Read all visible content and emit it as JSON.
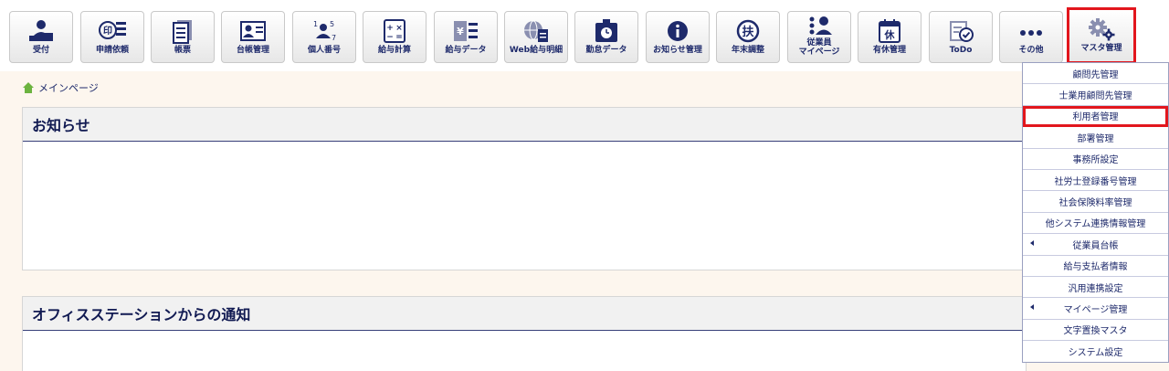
{
  "toolbar": {
    "buttons": [
      {
        "id": "uketsuke",
        "label": "受付",
        "icon": "reception-icon"
      },
      {
        "id": "shinsei",
        "label": "申請依頼",
        "icon": "seal-stamp-icon"
      },
      {
        "id": "chohyo",
        "label": "帳票",
        "icon": "document-stack-icon"
      },
      {
        "id": "daicho",
        "label": "台帳管理",
        "icon": "id-card-icon"
      },
      {
        "id": "kojin",
        "label": "個人番号",
        "icon": "person-number-icon"
      },
      {
        "id": "kyuyo",
        "label": "給与計算",
        "icon": "calculator-icon"
      },
      {
        "id": "kyuyodata",
        "label": "給与データ",
        "icon": "yen-list-icon"
      },
      {
        "id": "webmeisai",
        "label": "Web給与明細",
        "icon": "globe-document-icon"
      },
      {
        "id": "kintai",
        "label": "勤怠データ",
        "icon": "time-card-icon"
      },
      {
        "id": "oshirase",
        "label": "お知らせ管理",
        "icon": "info-icon"
      },
      {
        "id": "nenmatsu",
        "label": "年末調整",
        "icon": "fu-kanji-icon"
      },
      {
        "id": "mypage",
        "label": "従業員\nマイページ",
        "icon": "employees-icon"
      },
      {
        "id": "yukyu",
        "label": "有休管理",
        "icon": "calendar-kyu-icon"
      },
      {
        "id": "todo",
        "label": "ToDo",
        "icon": "todo-check-icon"
      },
      {
        "id": "other",
        "label": "その他",
        "icon": "more-dots-icon"
      },
      {
        "id": "master",
        "label": "マスタ管理",
        "icon": "gear-icon"
      }
    ]
  },
  "breadcrumb": {
    "home_label": "メインページ"
  },
  "panels": {
    "notice_title": "お知らせ",
    "office_title": "オフィスステーションからの通知"
  },
  "menu": {
    "items": [
      {
        "label": "顧問先管理",
        "arrow": false
      },
      {
        "label": "士業用顧問先管理",
        "arrow": false
      },
      {
        "label": "利用者管理",
        "arrow": false,
        "highlight": true
      },
      {
        "label": "部署管理",
        "arrow": false
      },
      {
        "label": "事務所設定",
        "arrow": false
      },
      {
        "label": "社労士登録番号管理",
        "arrow": false
      },
      {
        "label": "社会保険料率管理",
        "arrow": false
      },
      {
        "label": "他システム連携情報管理",
        "arrow": false
      },
      {
        "label": "従業員台帳",
        "arrow": true
      },
      {
        "label": "給与支払者情報",
        "arrow": false
      },
      {
        "label": "汎用連携設定",
        "arrow": false
      },
      {
        "label": "マイページ管理",
        "arrow": true
      },
      {
        "label": "文字置換マスタ",
        "arrow": false
      },
      {
        "label": "システム設定",
        "arrow": false
      }
    ]
  },
  "colors": {
    "navy": "#1e2a6b",
    "highlight_red": "#e2161d",
    "home_green": "#6cb33f"
  }
}
